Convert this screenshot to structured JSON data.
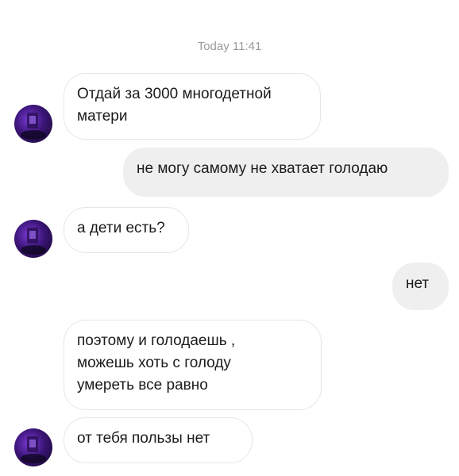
{
  "chat": {
    "timestamp": "Today 11:41",
    "messages": [
      {
        "sender": "them",
        "text": "Отдай за 3000 многодетной\nматери"
      },
      {
        "sender": "me",
        "text": "не могу самому не хватает голодаю"
      },
      {
        "sender": "them",
        "text": "а дети есть?"
      },
      {
        "sender": "me",
        "text": "нет"
      },
      {
        "sender": "them",
        "text": "поэтому и голодаешь ,\nможешь хоть с голоду\nумереть все равно"
      },
      {
        "sender": "them",
        "text": "от тебя пользы нет"
      }
    ]
  },
  "colors": {
    "incoming_bubble": "#ffffff",
    "outgoing_bubble": "#efefef",
    "timestamp_text": "#9a9a9a",
    "avatar_accent": "#7a3bd6"
  }
}
